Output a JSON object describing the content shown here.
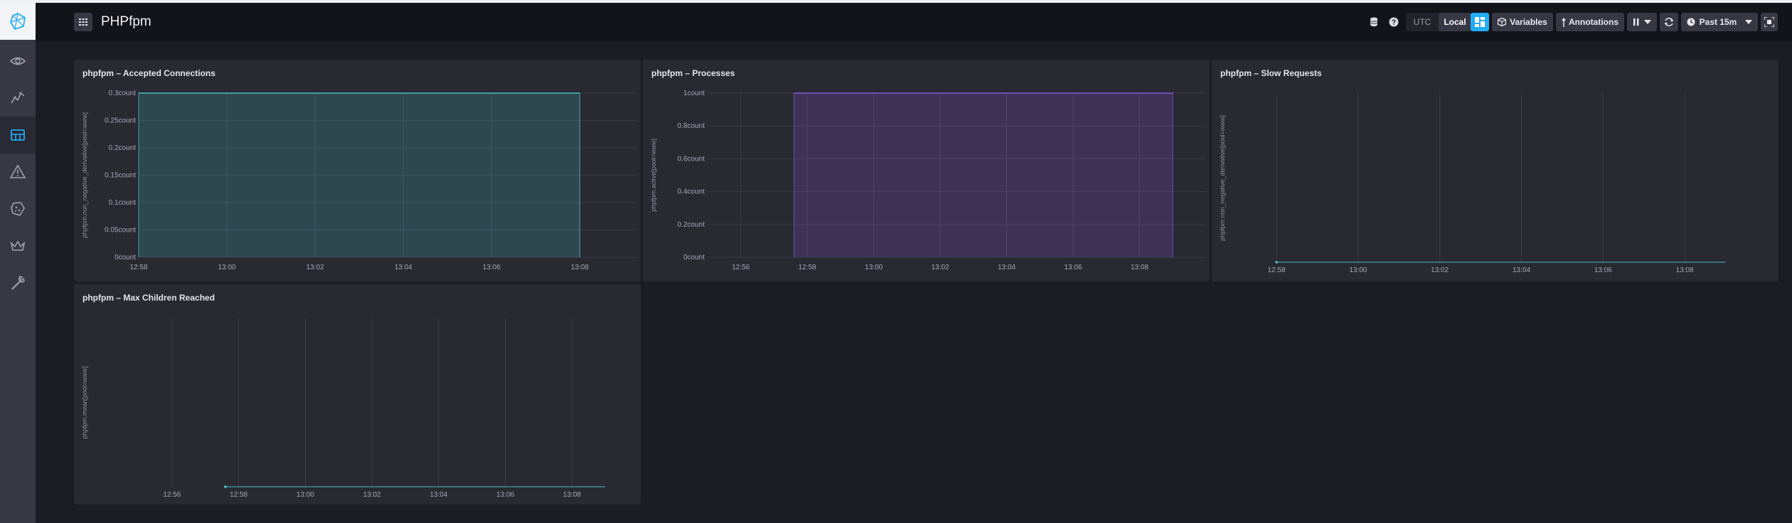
{
  "app": {
    "title": "PHPfpm"
  },
  "nav": {
    "items": [
      {
        "name": "nav-data-explorer",
        "icon": "eye-icon"
      },
      {
        "name": "nav-graph",
        "icon": "graph-icon"
      },
      {
        "name": "nav-dashboards",
        "icon": "dashboard-icon"
      },
      {
        "name": "nav-alerts",
        "icon": "alert-triangle-icon"
      },
      {
        "name": "nav-log-viewer",
        "icon": "cookie-icon"
      },
      {
        "name": "nav-admin",
        "icon": "crown-icon"
      },
      {
        "name": "nav-config",
        "icon": "wrench-icon"
      }
    ]
  },
  "header": {
    "timezone": {
      "utc": "UTC",
      "local": "Local"
    },
    "variables_label": "Variables",
    "annotations_label": "Annotations",
    "time_range": "Past 15m"
  },
  "colors": {
    "teal": "#4ed8da",
    "purple": "#9b5cf6",
    "accent_blue": "#22adf6"
  },
  "chart_data": [
    {
      "type": "area",
      "title": "phpfpm – Accepted Connections",
      "ylabel": "phpfpm.non_negative_derivative[pool=www]",
      "xlabel": "",
      "x_ticks": [
        "12:58",
        "13:00",
        "13:02",
        "13:04",
        "13:06",
        "13:08"
      ],
      "y_ticks": [
        "0count",
        "0.05count",
        "0.1count",
        "0.15count",
        "0.2count",
        "0.25count",
        "0.3count"
      ],
      "ylim": [
        0,
        0.3
      ],
      "grid": true,
      "color": "#4ed8da",
      "series": [
        {
          "x": [
            "12:58",
            "13:08"
          ],
          "values": [
            0.3,
            0.3
          ]
        }
      ]
    },
    {
      "type": "area",
      "title": "phpfpm – Processes",
      "ylabel": "phpfpm.active[pool=www]",
      "xlabel": "",
      "x_ticks": [
        "12:56",
        "12:58",
        "13:00",
        "13:02",
        "13:04",
        "13:06",
        "13:08"
      ],
      "y_ticks": [
        "0count",
        "0.2count",
        "0.4count",
        "0.6count",
        "0.8count",
        "1count"
      ],
      "ylim": [
        0,
        1
      ],
      "grid": true,
      "color": "#9b5cf6",
      "series": [
        {
          "x": [
            "12:57.6",
            "13:09"
          ],
          "values": [
            1,
            1
          ]
        }
      ]
    },
    {
      "type": "line",
      "title": "phpfpm – Slow Requests",
      "ylabel": "phpfpm.non_negative_derivative[pool=www]",
      "xlabel": "",
      "x_ticks": [
        "12:58",
        "13:00",
        "13:02",
        "13:04",
        "13:06",
        "13:08"
      ],
      "y_ticks": [],
      "grid": true,
      "color": "#4ed8da",
      "series": [
        {
          "x": [
            "12:58",
            "13:09"
          ],
          "values": [
            0,
            0
          ]
        }
      ]
    },
    {
      "type": "line",
      "title": "phpfpm – Max Children Reached",
      "ylabel": "phpfpm.mean[pool=www]",
      "xlabel": "",
      "x_ticks": [
        "12:56",
        "12:58",
        "13:00",
        "13:02",
        "13:04",
        "13:06",
        "13:08"
      ],
      "y_ticks": [],
      "grid": true,
      "color": "#4ed8da",
      "series": [
        {
          "x": [
            "12:57.6",
            "13:09"
          ],
          "values": [
            0,
            0
          ]
        }
      ]
    }
  ]
}
